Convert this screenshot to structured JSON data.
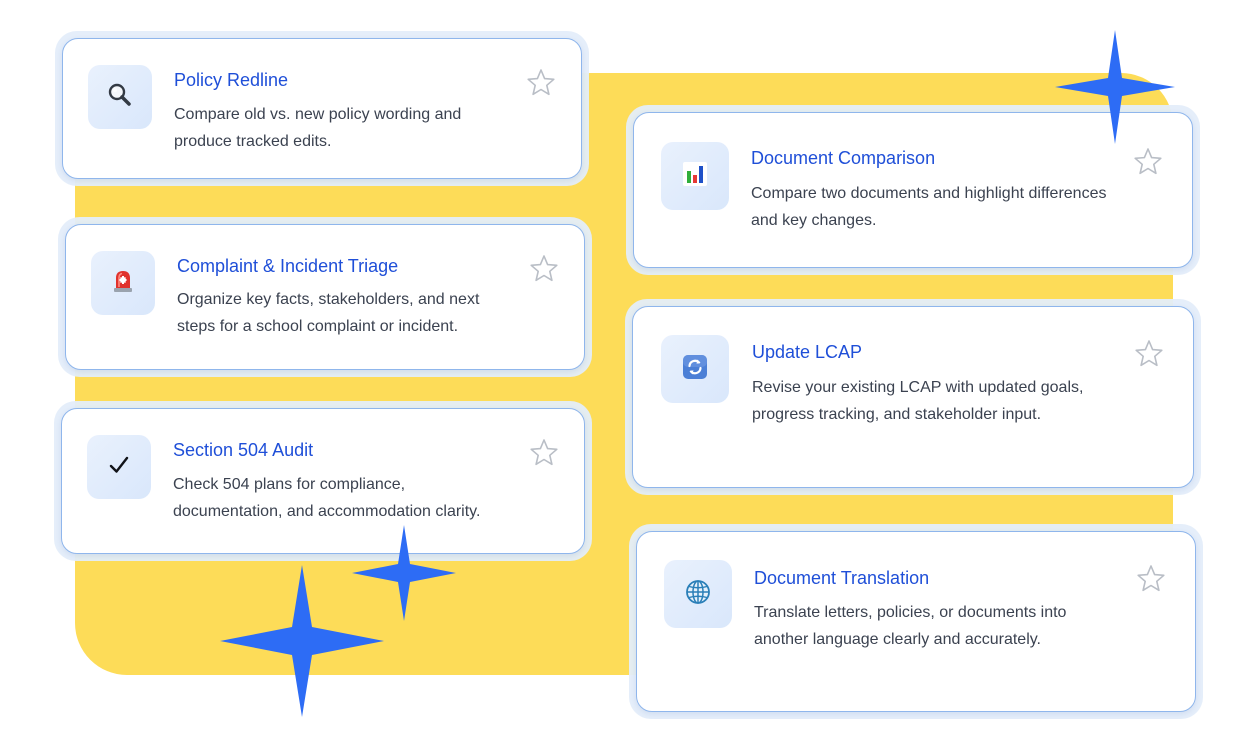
{
  "cards": [
    {
      "title": "Policy Redline",
      "description": "Compare old vs. new policy wording and produce tracked edits.",
      "icon": "magnifying-glass-icon",
      "favorited": false
    },
    {
      "title": "Complaint & Incident Triage",
      "description": "Organize key facts, stakeholders, and next steps for a school complaint or incident.",
      "icon": "siren-icon",
      "favorited": false
    },
    {
      "title": "Section 504 Audit",
      "description": "Check 504 plans for compliance, documentation, and accommodation clarity.",
      "icon": "checkmark-icon",
      "favorited": false
    },
    {
      "title": "Document Comparison",
      "description": "Compare two documents and highlight differences and key changes.",
      "icon": "bar-chart-icon",
      "favorited": false
    },
    {
      "title": "Update LCAP",
      "description": "Revise your existing LCAP with updated goals, progress tracking, and stakeholder input.",
      "icon": "refresh-icon",
      "favorited": false
    },
    {
      "title": "Document Translation",
      "description": "Translate letters, policies, or documents into another language clearly and accurately.",
      "icon": "globe-icon",
      "favorited": false
    }
  ],
  "colors": {
    "accent_blue": "#1f4fd8",
    "sparkle_blue": "#2d6cf5",
    "highlight_yellow": "#fddc58",
    "card_border": "#8fb6ec"
  }
}
